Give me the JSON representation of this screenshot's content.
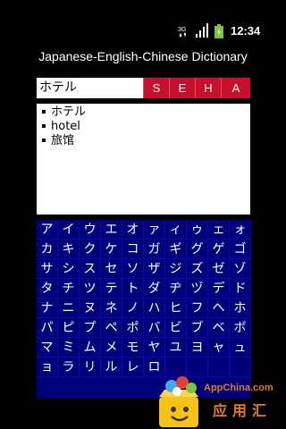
{
  "status_bar": {
    "network_label": "3G",
    "time": "12:34",
    "icons": [
      "3g-data-icon",
      "signal-icon",
      "battery-icon"
    ]
  },
  "app": {
    "title": "Japanese-English-Chinese Dictionary"
  },
  "search": {
    "value": "ホテル",
    "modes": [
      "S",
      "E",
      "H",
      "A"
    ]
  },
  "results": [
    "ホテル",
    "hotel",
    "旅馆"
  ],
  "kana_rows": [
    [
      "ア",
      "イ",
      "ウ",
      "エ",
      "オ",
      "ァ",
      "ィ",
      "ゥ",
      "ェ",
      "ォ"
    ],
    [
      "カ",
      "キ",
      "ク",
      "ケ",
      "コ",
      "ガ",
      "ギ",
      "グ",
      "ゲ",
      "ゴ"
    ],
    [
      "サ",
      "シ",
      "ス",
      "セ",
      "ソ",
      "ザ",
      "ジ",
      "ズ",
      "ゼ",
      "ゾ"
    ],
    [
      "タ",
      "チ",
      "ツ",
      "テ",
      "ト",
      "ダ",
      "ヂ",
      "ヅ",
      "デ",
      "ド"
    ],
    [
      "ナ",
      "ニ",
      "ヌ",
      "ネ",
      "ノ",
      "ハ",
      "ヒ",
      "フ",
      "ヘ",
      "ホ"
    ],
    [
      "パ",
      "ピ",
      "プ",
      "ペ",
      "ポ",
      "バ",
      "ビ",
      "ブ",
      "ベ",
      "ボ"
    ],
    [
      "マ",
      "ミ",
      "ム",
      "メ",
      "モ",
      "ヤ",
      "ユ",
      "ヨ",
      "ャ",
      "ュ"
    ],
    [
      "ョ",
      "ラ",
      "リ",
      "ル",
      "レ",
      "ロ",
      "",
      "",
      "",
      ""
    ]
  ],
  "watermark": {
    "site": "AppChina.com",
    "brand": "应用汇"
  },
  "colors": {
    "mode_button": "#c8102e",
    "keyboard_bg": "#00007a",
    "results_bg": "#ffffff",
    "background": "#000000"
  }
}
